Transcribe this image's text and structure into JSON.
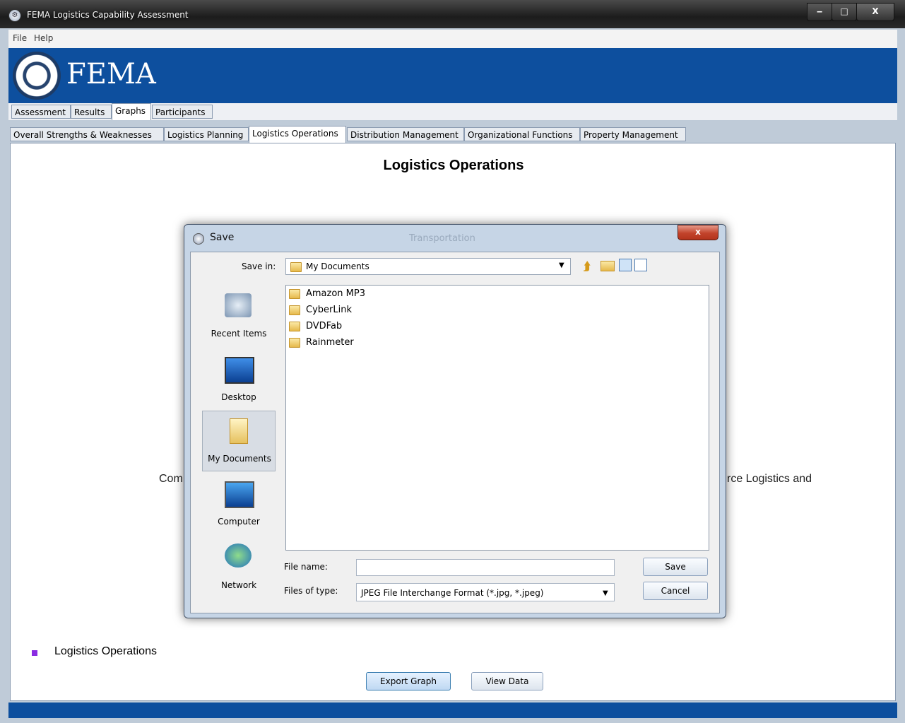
{
  "window": {
    "title": "FEMA Logistics Capability Assessment",
    "minimize": "‒",
    "maximize": "□",
    "close": "X"
  },
  "menu": [
    "File",
    "Help"
  ],
  "banner": {
    "logo_text": "FEMA"
  },
  "main_tabs": [
    {
      "label": "Assessment",
      "active": false
    },
    {
      "label": "Results",
      "active": false
    },
    {
      "label": "Graphs",
      "active": true
    },
    {
      "label": "Participants",
      "active": false
    }
  ],
  "sub_tabs": [
    {
      "label": "Overall Strengths & Weaknesses",
      "active": false
    },
    {
      "label": "Logistics Planning",
      "active": false
    },
    {
      "label": "Logistics Operations",
      "active": true
    },
    {
      "label": "Distribution Management",
      "active": false
    },
    {
      "label": "Organizational Functions",
      "active": false
    },
    {
      "label": "Property Management",
      "active": false
    }
  ],
  "chart": {
    "title": "Logistics Operations",
    "partial_left_label": "Com",
    "partial_right_label": "rce Logistics and",
    "legend": "Logistics Operations",
    "legend_color": "#8a2be2"
  },
  "buttons": {
    "export": "Export Graph",
    "view_data": "View Data"
  },
  "dialog": {
    "title": "Save",
    "behind_text": "Transportation",
    "close": "x",
    "save_in_label": "Save in:",
    "save_in_value": "My Documents",
    "places": [
      {
        "label": "Recent Items",
        "icon": "recent-items-icon"
      },
      {
        "label": "Desktop",
        "icon": "desktop-icon"
      },
      {
        "label": "My Documents",
        "icon": "my-documents-icon",
        "selected": true
      },
      {
        "label": "Computer",
        "icon": "computer-icon"
      },
      {
        "label": "Network",
        "icon": "network-icon"
      }
    ],
    "files": [
      "Amazon MP3",
      "CyberLink",
      "DVDFab",
      "Rainmeter"
    ],
    "file_name_label": "File name:",
    "file_name_value": "",
    "file_type_label": "Files of type:",
    "file_type_value": "JPEG File Interchange Format (*.jpg, *.jpeg)",
    "save_button": "Save",
    "cancel_button": "Cancel"
  }
}
